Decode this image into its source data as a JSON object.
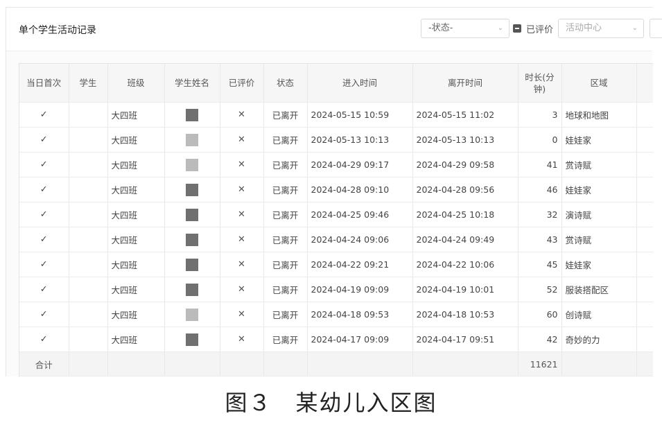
{
  "header": {
    "title": "单个学生活动记录",
    "status_select": "-状态-",
    "evaluated_label": "已评价",
    "center_select_placeholder": "活动中心"
  },
  "table": {
    "columns": [
      "当日首次",
      "学生",
      "班级",
      "学生姓名",
      "已评价",
      "状态",
      "进入时间",
      "离开时间",
      "时长(分钟)",
      "区域"
    ],
    "rows": [
      {
        "first": "✓",
        "student": "",
        "class": "大四班",
        "name_redacted": true,
        "evaluated": "✕",
        "status": "已离开",
        "enter": "2024-05-15 10:59",
        "leave": "2024-05-15 11:02",
        "duration": "3",
        "area": "地球和地图"
      },
      {
        "first": "✓",
        "student": "",
        "class": "大四班",
        "name_redacted": true,
        "evaluated": "✕",
        "status": "已离开",
        "enter": "2024-05-13 10:13",
        "leave": "2024-05-13 10:13",
        "duration": "0",
        "area": "娃娃家"
      },
      {
        "first": "✓",
        "student": "",
        "class": "大四班",
        "name_redacted": true,
        "evaluated": "✕",
        "status": "已离开",
        "enter": "2024-04-29 09:17",
        "leave": "2024-04-29 09:58",
        "duration": "41",
        "area": "赏诗赋"
      },
      {
        "first": "✓",
        "student": "",
        "class": "大四班",
        "name_redacted": true,
        "evaluated": "✕",
        "status": "已离开",
        "enter": "2024-04-28 09:10",
        "leave": "2024-04-28 09:56",
        "duration": "46",
        "area": "娃娃家"
      },
      {
        "first": "✓",
        "student": "",
        "class": "大四班",
        "name_redacted": true,
        "evaluated": "✕",
        "status": "已离开",
        "enter": "2024-04-25 09:46",
        "leave": "2024-04-25 10:18",
        "duration": "32",
        "area": "演诗赋"
      },
      {
        "first": "✓",
        "student": "",
        "class": "大四班",
        "name_redacted": true,
        "evaluated": "✕",
        "status": "已离开",
        "enter": "2024-04-24 09:06",
        "leave": "2024-04-24 09:49",
        "duration": "43",
        "area": "赏诗赋"
      },
      {
        "first": "✓",
        "student": "",
        "class": "大四班",
        "name_redacted": true,
        "evaluated": "✕",
        "status": "已离开",
        "enter": "2024-04-22 09:21",
        "leave": "2024-04-22 10:06",
        "duration": "45",
        "area": "娃娃家"
      },
      {
        "first": "✓",
        "student": "",
        "class": "大四班",
        "name_redacted": true,
        "evaluated": "✕",
        "status": "已离开",
        "enter": "2024-04-19 09:09",
        "leave": "2024-04-19 10:01",
        "duration": "52",
        "area": "服装搭配区"
      },
      {
        "first": "✓",
        "student": "",
        "class": "大四班",
        "name_redacted": true,
        "evaluated": "✕",
        "status": "已离开",
        "enter": "2024-04-18 09:53",
        "leave": "2024-04-18 10:53",
        "duration": "60",
        "area": "创诗赋"
      },
      {
        "first": "✓",
        "student": "",
        "class": "大四班",
        "name_redacted": true,
        "evaluated": "✕",
        "status": "已离开",
        "enter": "2024-04-17 09:09",
        "leave": "2024-04-17 09:51",
        "duration": "42",
        "area": "奇妙的力"
      }
    ],
    "total_label": "合计",
    "total_duration": "11621"
  },
  "caption": "图３　某幼儿入区图"
}
